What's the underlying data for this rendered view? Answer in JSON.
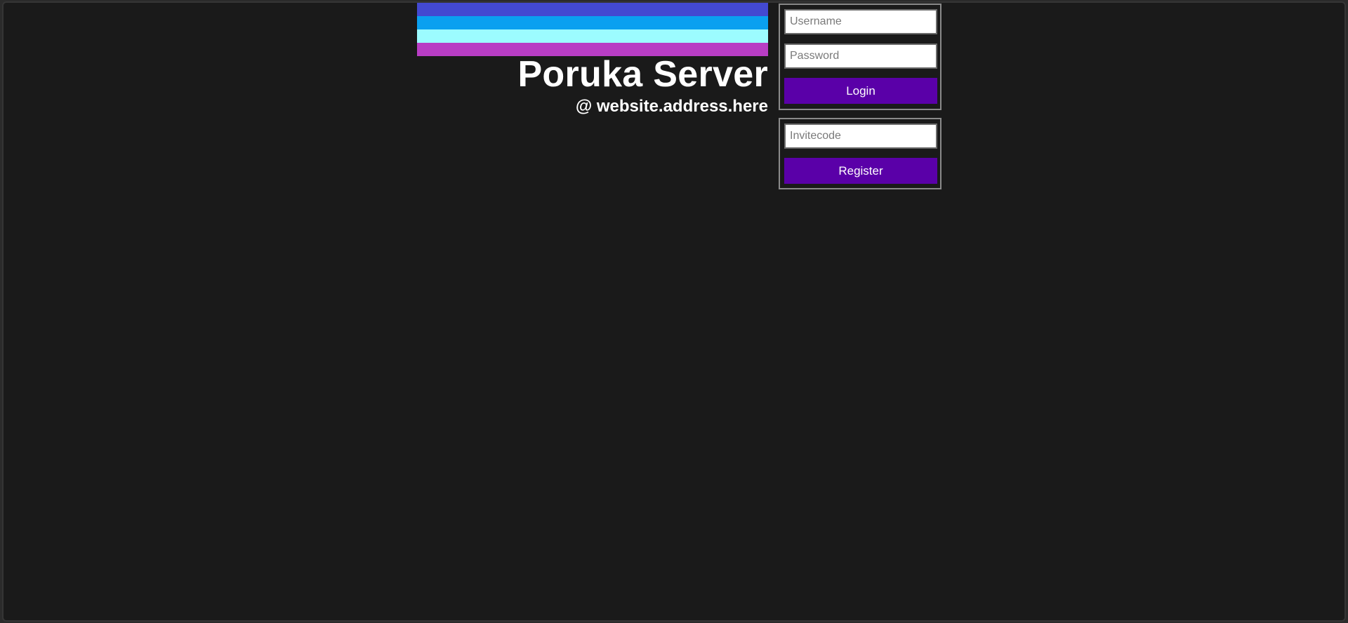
{
  "header": {
    "title": "Poruka Server",
    "subtitle": "@ website.address.here",
    "banner_colors": [
      "#4349d1",
      "#0aa0f0",
      "#9cfcff",
      "#b83dc4"
    ]
  },
  "login": {
    "username_placeholder": "Username",
    "password_placeholder": "Password",
    "button_label": "Login"
  },
  "register": {
    "invitecode_placeholder": "Invitecode",
    "button_label": "Register"
  },
  "colors": {
    "background": "#1a1a1a",
    "button": "#5a00a8",
    "panel_border": "#8a8a8a"
  }
}
